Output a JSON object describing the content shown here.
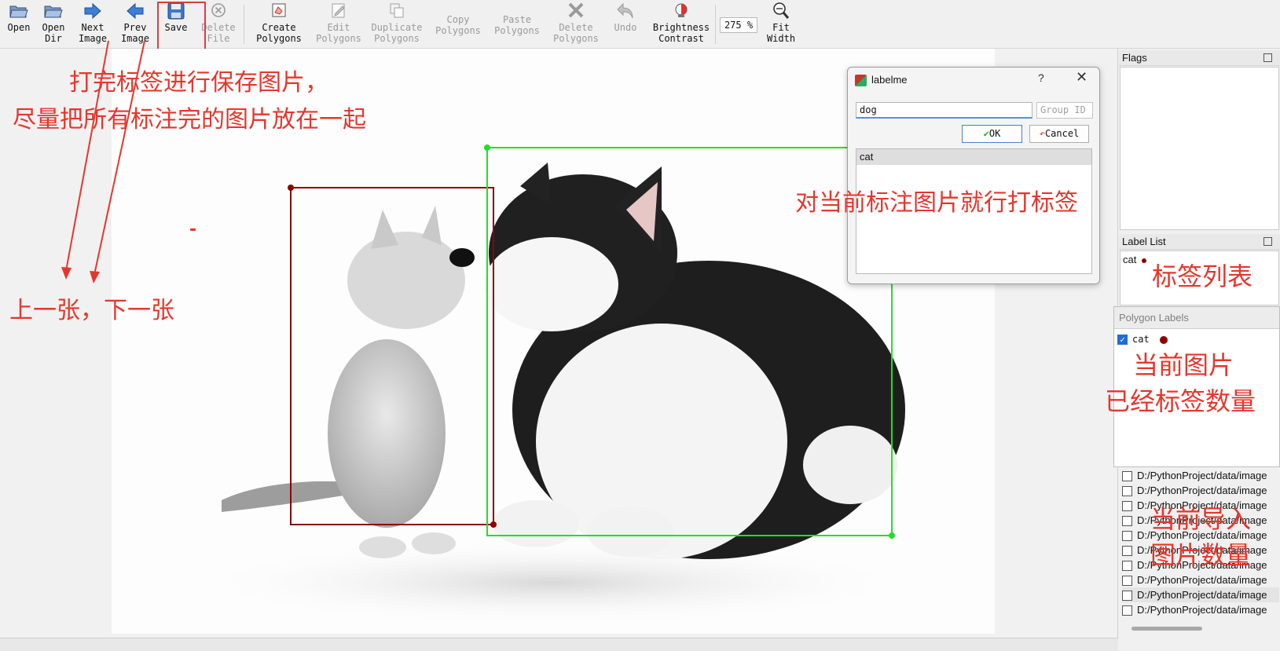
{
  "toolbar": {
    "open": "Open",
    "open_dir_1": "Open",
    "open_dir_2": "Dir",
    "next_1": "Next",
    "next_2": "Image",
    "prev_1": "Prev",
    "prev_2": "Image",
    "save": "Save",
    "delete_file_1": "Delete",
    "delete_file_2": "File",
    "create_1": "Create",
    "create_2": "Polygons",
    "edit_1": "Edit",
    "edit_2": "Polygons",
    "dup_1": "Duplicate",
    "dup_2": "Polygons",
    "copy_1": "Copy",
    "copy_2": "Polygons",
    "paste_1": "Paste",
    "paste_2": "Polygons",
    "del_poly_1": "Delete",
    "del_poly_2": "Polygons",
    "undo": "Undo",
    "bright_1": "Brightness",
    "bright_2": "Contrast",
    "zoom": "275 %",
    "fit_1": "Fit",
    "fit_2": "Width"
  },
  "docks": {
    "flags_title": "Flags",
    "label_list_title": "Label List",
    "label_list_items": [
      {
        "label": "cat",
        "color": "#8b0000"
      }
    ],
    "polygon_labels_title": "Polygon Labels",
    "polygon_items": [
      {
        "label": "cat",
        "checked": true,
        "color": "#8b0000"
      }
    ]
  },
  "files": {
    "items": [
      "D:/PythonProject/data/image",
      "D:/PythonProject/data/image",
      "D:/PythonProject/data/image",
      "D:/PythonProject/data/image",
      "D:/PythonProject/data/image",
      "D:/PythonProject/data/image",
      "D:/PythonProject/data/image",
      "D:/PythonProject/data/image",
      "D:/PythonProject/data/image",
      "D:/PythonProject/data/image"
    ],
    "selected_index": 8
  },
  "dialog": {
    "title": "labelme",
    "help": "?",
    "close": "✕",
    "label_value": "dog",
    "group_placeholder": "Group ID",
    "ok": "OK",
    "cancel": "Cancel",
    "list_items": [
      "cat"
    ]
  },
  "annotations": {
    "save_note_1": "打完标签进行保存图片，",
    "save_note_2": "尽量把所有标注完的图片放在一起",
    "nav_note": "上一张，下一张",
    "dialog_note": "对当前标注图片就行打标签",
    "label_list_note": "标签列表",
    "count_note_1": "当前图片",
    "count_note_2": "已经标签数量",
    "import_note_1": "当前导入",
    "import_note_2": "图片数量",
    "dash": "-"
  },
  "shapes": {
    "cat_box_color": "#8b0000",
    "dog_box_color": "#22e022"
  },
  "colors": {
    "annotation_red": "#e6362c",
    "accent_blue": "#1f6fd1"
  }
}
